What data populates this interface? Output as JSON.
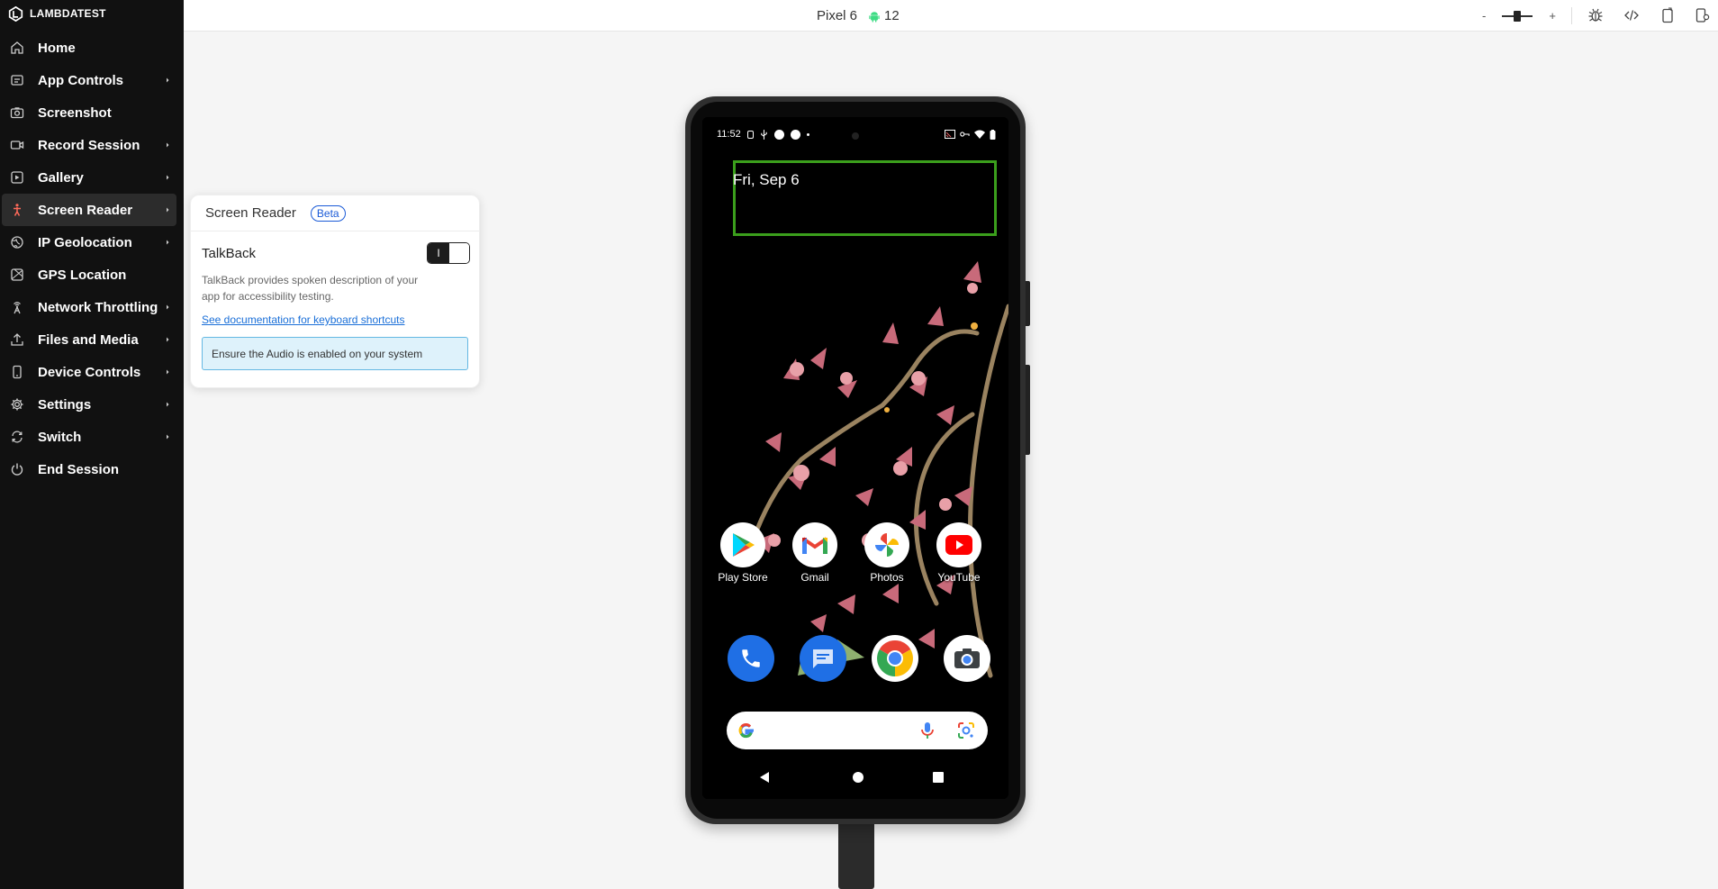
{
  "brand": {
    "name": "LAMBDATEST"
  },
  "sidebar": {
    "items": [
      {
        "label": "Home",
        "icon": "home-icon",
        "submenu": false,
        "active": false
      },
      {
        "label": "App Controls",
        "icon": "app-controls-icon",
        "submenu": true,
        "active": false
      },
      {
        "label": "Screenshot",
        "icon": "camera-icon",
        "submenu": false,
        "active": false
      },
      {
        "label": "Record Session",
        "icon": "video-icon",
        "submenu": true,
        "active": false
      },
      {
        "label": "Gallery",
        "icon": "gallery-icon",
        "submenu": true,
        "active": false
      },
      {
        "label": "Screen Reader",
        "icon": "accessibility-icon",
        "submenu": true,
        "active": true
      },
      {
        "label": "IP Geolocation",
        "icon": "globe-icon",
        "submenu": true,
        "active": false
      },
      {
        "label": "GPS Location",
        "icon": "map-icon",
        "submenu": false,
        "active": false
      },
      {
        "label": "Network Throttling",
        "icon": "antenna-icon",
        "submenu": true,
        "active": false
      },
      {
        "label": "Files and Media",
        "icon": "upload-icon",
        "submenu": true,
        "active": false
      },
      {
        "label": "Device Controls",
        "icon": "phone-icon",
        "submenu": true,
        "active": false
      },
      {
        "label": "Settings",
        "icon": "gear-icon",
        "submenu": true,
        "active": false
      },
      {
        "label": "Switch",
        "icon": "switch-icon",
        "submenu": true,
        "active": false
      },
      {
        "label": "End Session",
        "icon": "power-icon",
        "submenu": false,
        "active": false
      }
    ]
  },
  "topbar": {
    "device_name": "Pixel 6",
    "os_version": "12",
    "zoom_minus": "-",
    "zoom_plus": "+"
  },
  "screen_reader": {
    "title": "Screen Reader",
    "badge": "Beta",
    "talkback_title": "TalkBack",
    "toggle_mark": "I",
    "description": "TalkBack provides spoken description of your app for accessibility testing.",
    "doc_link": "See documentation for keyboard shortcuts",
    "note": "Ensure the Audio is enabled on your system"
  },
  "device": {
    "time": "11:52",
    "date": "Fri, Sep 6",
    "apps": [
      {
        "label": "Play Store"
      },
      {
        "label": "Gmail"
      },
      {
        "label": "Photos"
      },
      {
        "label": "YouTube"
      }
    ]
  },
  "colors": {
    "sidebar_bg": "#111111",
    "accent_green": "#3b9f1c",
    "link_blue": "#1a6fd8",
    "note_bg": "#def2fb"
  }
}
